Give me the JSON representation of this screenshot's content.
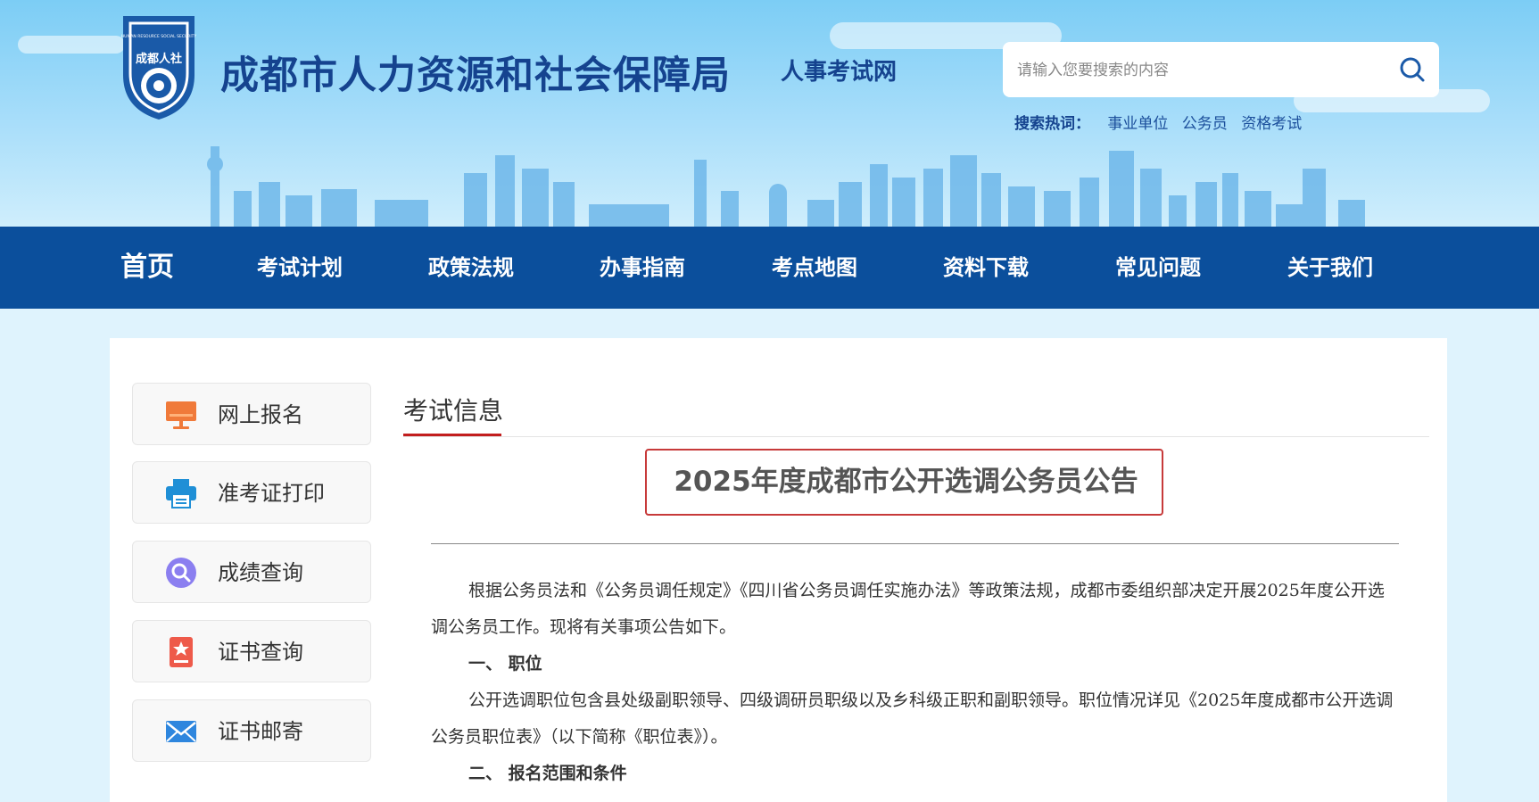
{
  "header": {
    "logo_text": "成都人社",
    "logo_ring_text": "HUMAN RESOURCE SOCIAL SECURITY",
    "title": "成都市人力资源和社会保障局",
    "subtitle": "人事考试网",
    "search": {
      "placeholder": "请输入您要搜索的内容"
    },
    "hot_label": "搜索热词：",
    "hot_links": [
      "事业单位",
      "公务员",
      "资格考试"
    ]
  },
  "nav": {
    "items": [
      "首页",
      "考试计划",
      "政策法规",
      "办事指南",
      "考点地图",
      "资料下载",
      "常见问题",
      "关于我们"
    ]
  },
  "sidebar": {
    "items": [
      {
        "label": "网上报名",
        "icon": "monitor-icon"
      },
      {
        "label": "准考证打印",
        "icon": "printer-icon"
      },
      {
        "label": "成绩查询",
        "icon": "search-icon"
      },
      {
        "label": "证书查询",
        "icon": "certificate-icon"
      },
      {
        "label": "证书邮寄",
        "icon": "mail-icon"
      }
    ]
  },
  "main": {
    "section_title": "考试信息",
    "article": {
      "title": "2025年度成都市公开选调公务员公告",
      "paragraphs": [
        "根据公务员法和《公务员调任规定》《四川省公务员调任实施办法》等政策法规，成都市委组织部决定开展2025年度公开选调公务员工作。现将有关事项公告如下。",
        "一、  职位",
        "公开选调职位包含县处级副职领导、四级调研员职级以及乡科级正职和副职领导。职位情况详见《2025年度成都市公开选调公务员职位表》（以下简称《职位表》）。",
        "二、  报名范围和条件"
      ]
    }
  },
  "colors": {
    "nav_bg": "#0b4f9c",
    "title_blue": "#15438f",
    "accent_red": "#c21e1e"
  }
}
